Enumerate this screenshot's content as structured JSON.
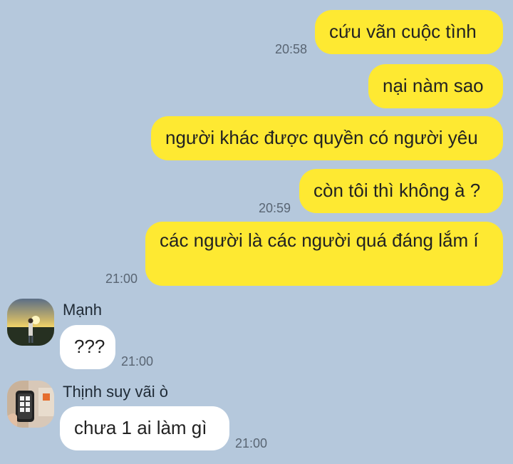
{
  "messages": [
    {
      "text": "cứu vãn cuộc tình",
      "time": "20:58"
    },
    {
      "text": "nại nàm sao"
    },
    {
      "text": "người khác được quyền có người yêu"
    },
    {
      "text": "còn tôi thì không à ?",
      "time": "20:59"
    },
    {
      "text": "các người là các người quá đáng lắm í",
      "time": "21:00"
    },
    {
      "sender": "Mạnh",
      "avatar_icon": "sunset-person-avatar",
      "text": "???",
      "time": "21:00"
    },
    {
      "sender": "Thịnh suy vãi ò",
      "avatar_icon": "selfie-avatar",
      "text": "chưa 1 ai làm gì",
      "time": "21:00"
    }
  ],
  "colors": {
    "background": "#b5c8dc",
    "outgoing_bubble": "#fee932",
    "incoming_bubble": "#ffffff",
    "time_text": "#596573"
  }
}
